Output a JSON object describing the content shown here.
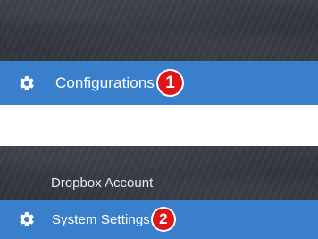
{
  "step1": {
    "label": "Configurations",
    "icon": "gear-icon",
    "badge": "1"
  },
  "step2": {
    "above_item": "Dropbox Account",
    "label": "System Settings",
    "icon": "gear-icon",
    "badge": "2"
  },
  "colors": {
    "menu_highlight": "#3a7fcc",
    "sidebar_dark": "#2c3139",
    "badge": "#e01616"
  }
}
